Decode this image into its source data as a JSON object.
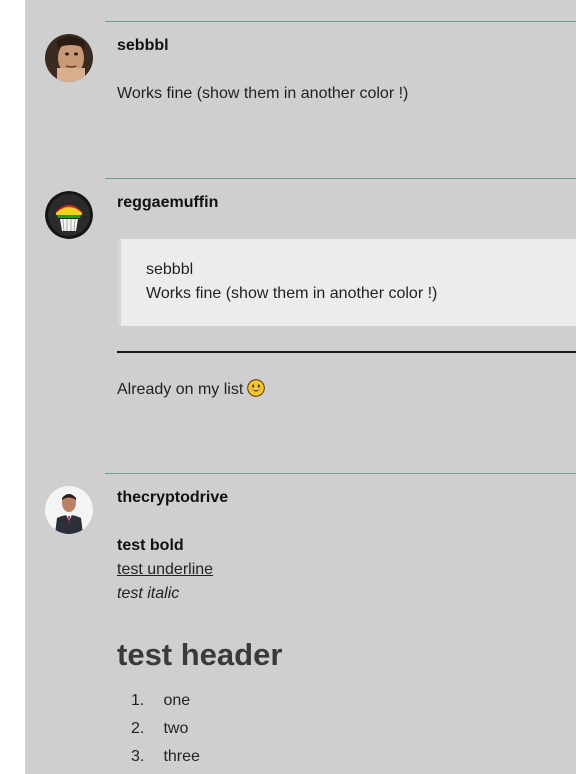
{
  "posts": [
    {
      "username": "sebbbl",
      "body": "Works fine (show them in another color !)"
    },
    {
      "username": "reggaemuffin",
      "quote": {
        "author": "sebbbl",
        "text": "Works fine (show them in another color !)"
      },
      "body": "Already on my list",
      "emoji": "grinning-face-emoji"
    },
    {
      "username": "thecryptodrive",
      "bold": "test bold",
      "underline": "test underline",
      "italic": "test italic",
      "header": "test header",
      "list": [
        {
          "num": "1.",
          "label": "one"
        },
        {
          "num": "2.",
          "label": "two"
        },
        {
          "num": "3.",
          "label": "three"
        }
      ]
    }
  ],
  "colors": {
    "page_bg": "#cfcfcf",
    "divider": "#6b9d9d",
    "quote_bg": "#ececec"
  }
}
